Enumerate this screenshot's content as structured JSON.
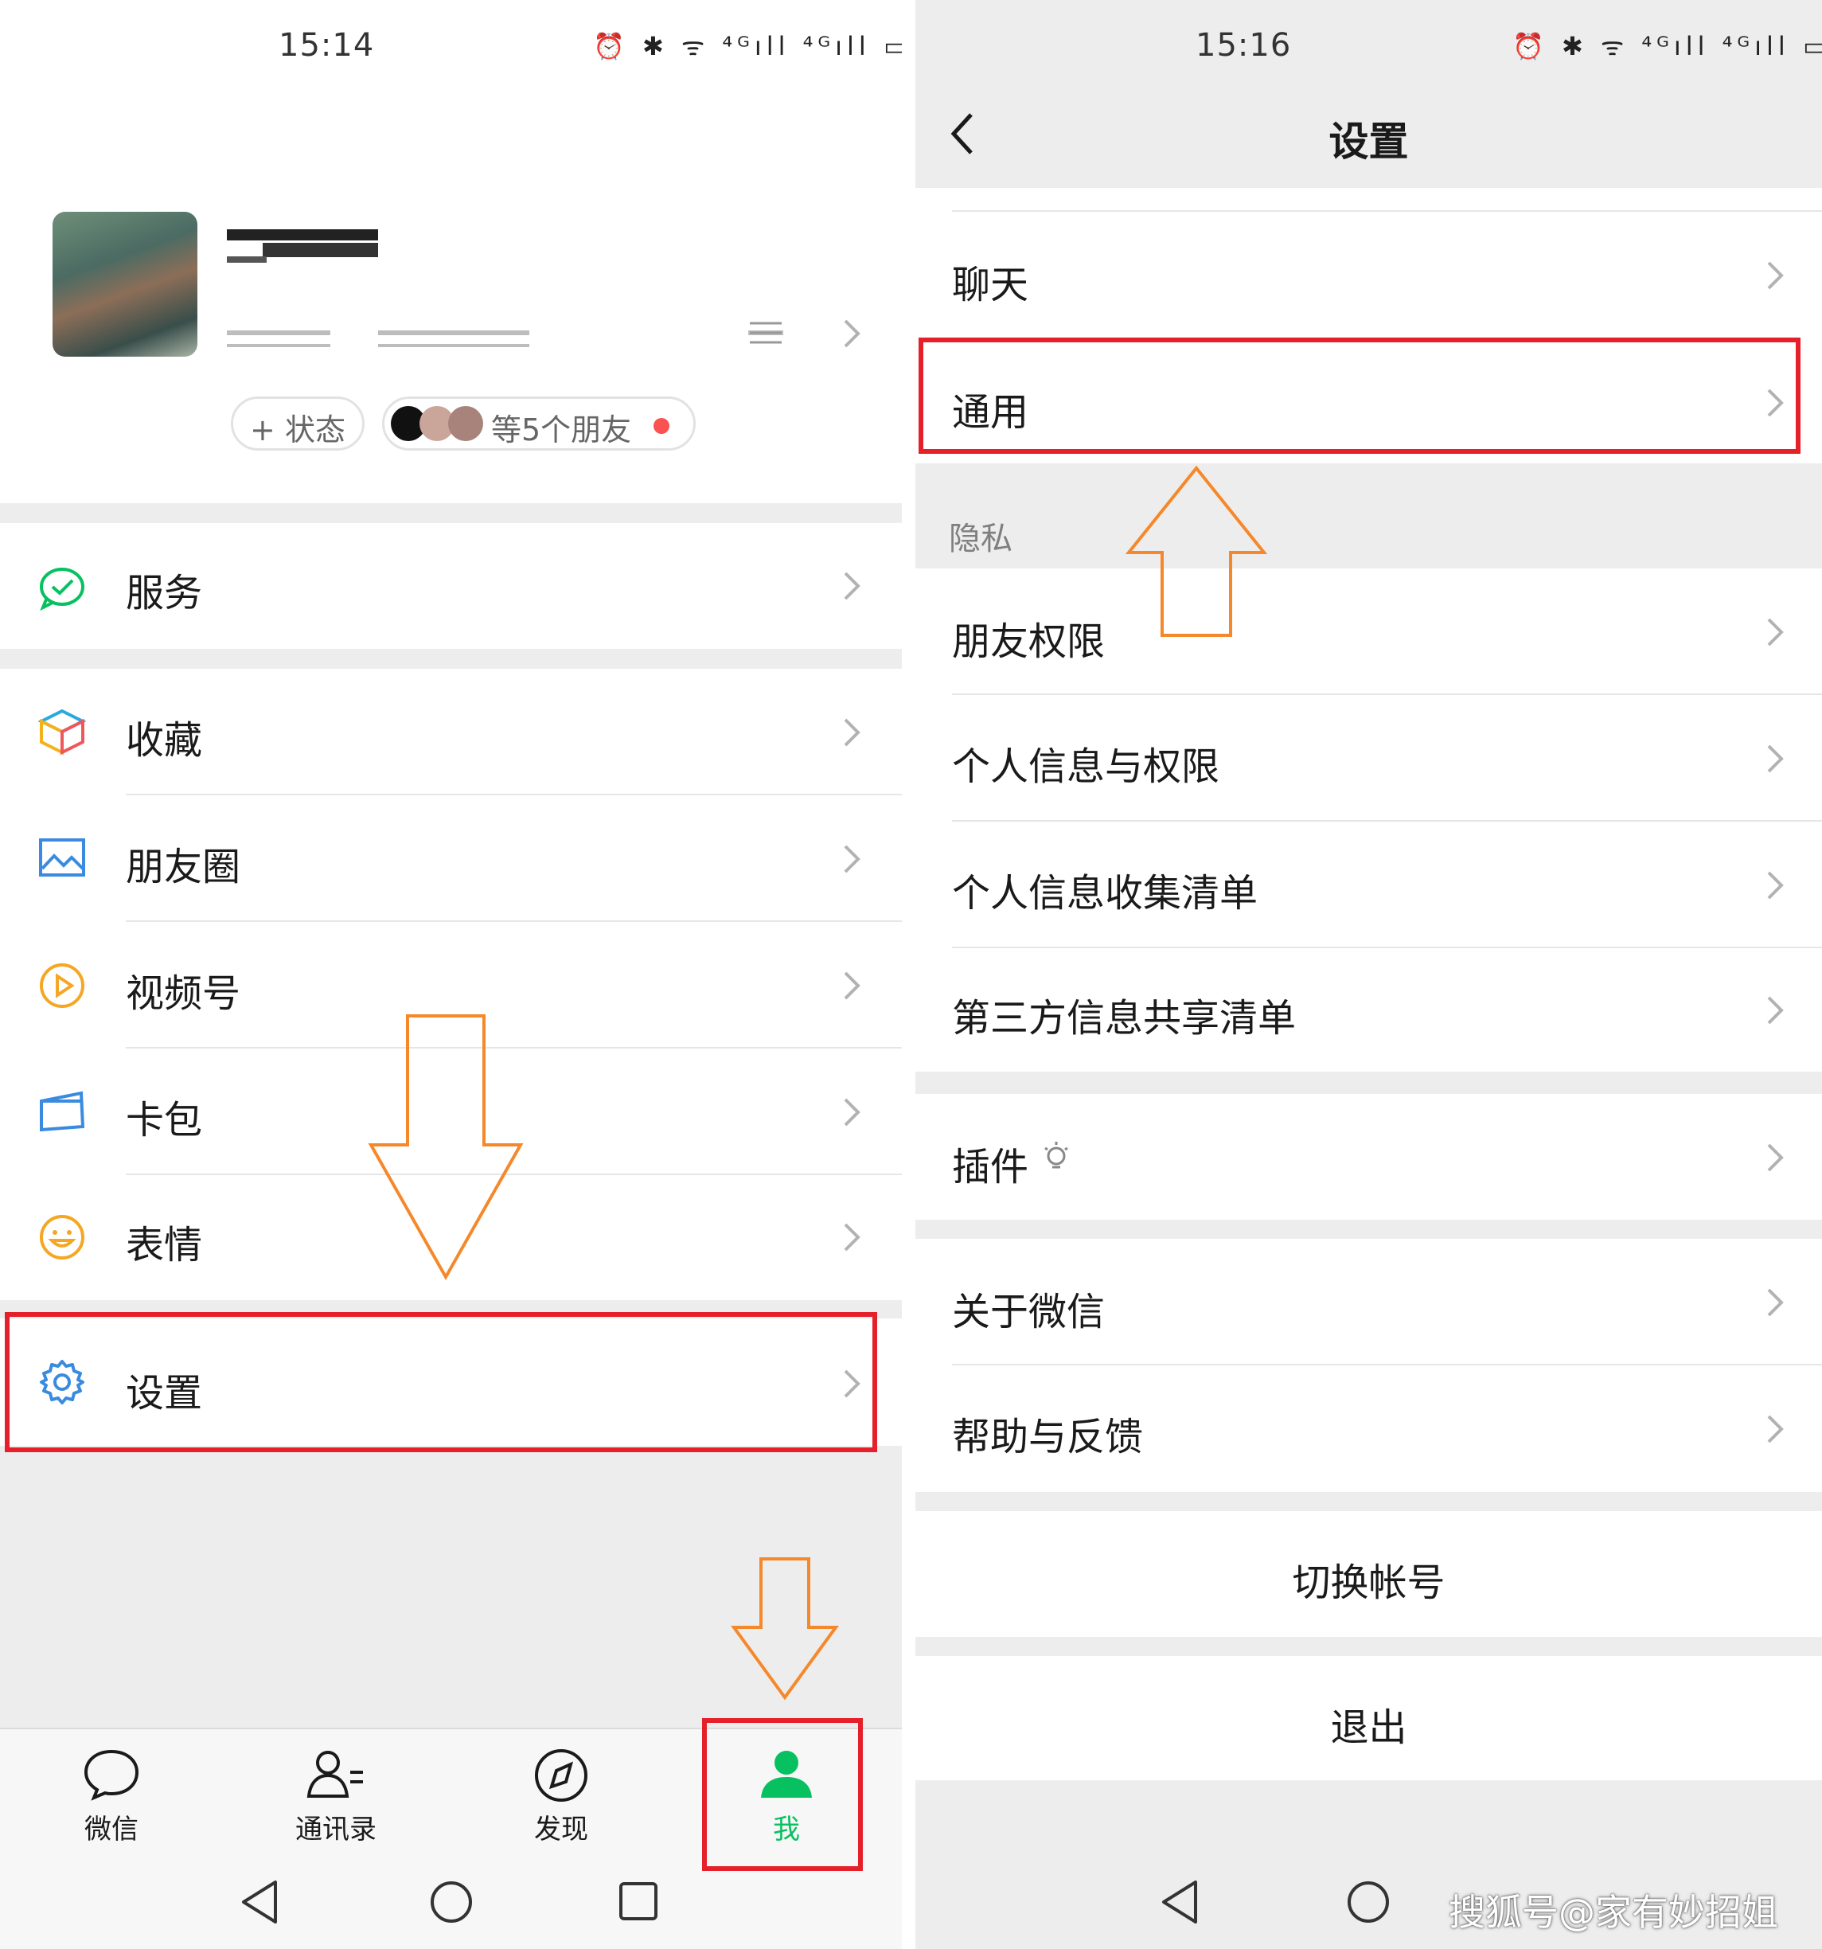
{
  "left_screen": {
    "status": {
      "time": "15:14",
      "icons": "⏰ ✱ ᯤ ⁴ᴳıll ⁴ᴳıll ▭"
    },
    "profile": {
      "status_button": "+ 状态",
      "friends_text": "等5个朋友"
    },
    "menu": {
      "services": "服务",
      "favorites": "收藏",
      "moments": "朋友圈",
      "channels": "视频号",
      "cards": "卡包",
      "stickers": "表情",
      "settings": "设置"
    },
    "tabbar": {
      "chats": "微信",
      "contacts": "通讯录",
      "discover": "发现",
      "me": "我"
    }
  },
  "right_screen": {
    "status": {
      "time": "15:16",
      "icons": "⏰ ✱ ᯤ ⁴ᴳıll ⁴ᴳıll ▭"
    },
    "title": "设置",
    "items": {
      "chat": "聊天",
      "general": "通用",
      "privacy_header": "隐私",
      "friend_permissions": "朋友权限",
      "personal_info_permissions": "个人信息与权限",
      "personal_info_list": "个人信息收集清单",
      "third_party_list": "第三方信息共享清单",
      "plugins": "插件",
      "about": "关于微信",
      "help": "帮助与反馈",
      "switch_account": "切换帐号",
      "logout": "退出"
    },
    "watermark": "搜狐号@家有妙招姐"
  },
  "colors": {
    "wechat_green": "#07c160",
    "annotation_red": "#e5202a",
    "annotation_orange": "#f5882a"
  }
}
